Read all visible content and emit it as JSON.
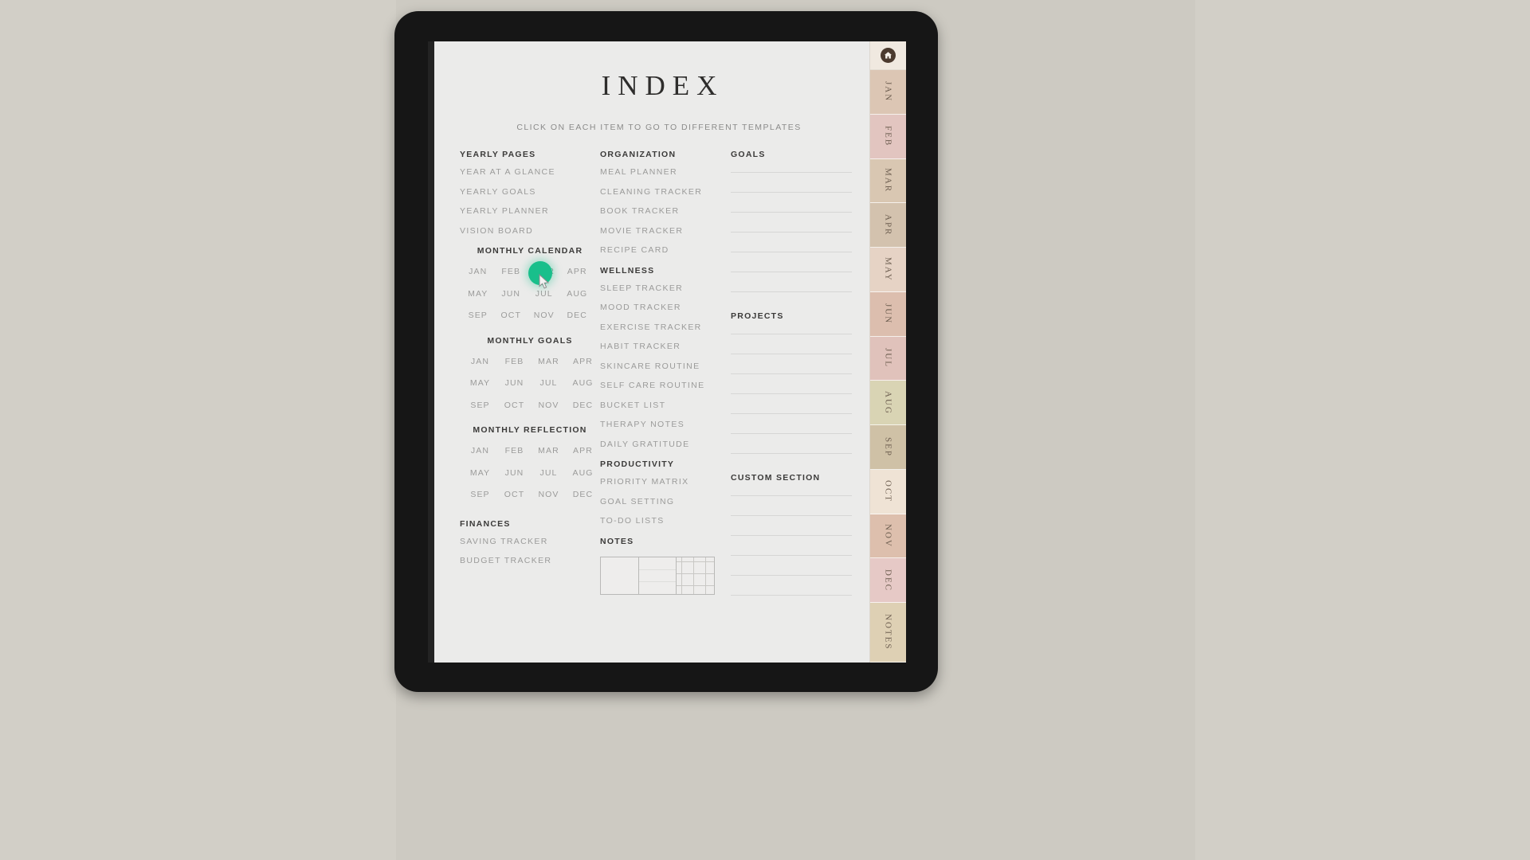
{
  "page": {
    "title": "INDEX",
    "subtitle": "CLICK ON EACH ITEM TO GO TO DIFFERENT TEMPLATES"
  },
  "columns": {
    "left": {
      "yearly": {
        "heading": "YEARLY PAGES",
        "items": [
          "YEAR AT A GLANCE",
          "YEARLY GOALS",
          "YEARLY PLANNER",
          "VISION BOARD"
        ]
      },
      "monthly_calendar": {
        "heading": "MONTHLY CALENDAR",
        "months": [
          "JAN",
          "FEB",
          "MAR",
          "APR",
          "MAY",
          "JUN",
          "JUL",
          "AUG",
          "SEP",
          "OCT",
          "NOV",
          "DEC"
        ]
      },
      "monthly_goals": {
        "heading": "MONTHLY GOALS",
        "months": [
          "JAN",
          "FEB",
          "MAR",
          "APR",
          "MAY",
          "JUN",
          "JUL",
          "AUG",
          "SEP",
          "OCT",
          "NOV",
          "DEC"
        ]
      },
      "monthly_reflection": {
        "heading": "MONTHLY REFLECTION",
        "months": [
          "JAN",
          "FEB",
          "MAR",
          "APR",
          "MAY",
          "JUN",
          "JUL",
          "AUG",
          "SEP",
          "OCT",
          "NOV",
          "DEC"
        ]
      },
      "finances": {
        "heading": "FINANCES",
        "items": [
          "SAVING TRACKER",
          "BUDGET TRACKER"
        ]
      }
    },
    "middle": {
      "organization": {
        "heading": "ORGANIZATION",
        "items": [
          "MEAL PLANNER",
          "CLEANING TRACKER",
          "BOOK TRACKER",
          "MOVIE TRACKER",
          "RECIPE CARD"
        ]
      },
      "wellness": {
        "heading": "WELLNESS",
        "items": [
          "SLEEP TRACKER",
          "MOOD TRACKER",
          "EXERCISE TRACKER",
          "HABIT TRACKER",
          "SKINCARE ROUTINE",
          "SELF CARE ROUTINE",
          "BUCKET LIST",
          "THERAPY NOTES",
          "DAILY GRATITUDE"
        ]
      },
      "productivity": {
        "heading": "PRODUCTIVITY",
        "items": [
          "PRIORITY MATRIX",
          "GOAL SETTING",
          "TO-DO LISTS"
        ]
      },
      "notes": {
        "heading": "NOTES",
        "box_types": [
          "blank",
          "lined",
          "grid"
        ]
      }
    },
    "right": {
      "goals": {
        "heading": "GOALS",
        "line_count": 7
      },
      "projects": {
        "heading": "PROJECTS",
        "line_count": 7
      },
      "custom_section": {
        "heading": "CUSTOM SECTION",
        "line_count": 6
      }
    }
  },
  "tab_strip": {
    "home_icon": "home-icon",
    "tabs": [
      {
        "label": "JAN",
        "color": "#dcc6b4"
      },
      {
        "label": "FEB",
        "color": "#e2c5c0"
      },
      {
        "label": "MAR",
        "color": "#d9c7b2"
      },
      {
        "label": "APR",
        "color": "#d3c2ae"
      },
      {
        "label": "MAY",
        "color": "#e6d3c5"
      },
      {
        "label": "JUN",
        "color": "#dcbeae"
      },
      {
        "label": "JUL",
        "color": "#e0c2bb"
      },
      {
        "label": "AUG",
        "color": "#d9d4b4"
      },
      {
        "label": "SEP",
        "color": "#cfc1a6"
      },
      {
        "label": "OCT",
        "color": "#efe3d5"
      },
      {
        "label": "NOV",
        "color": "#ddbfad"
      },
      {
        "label": "DEC",
        "color": "#e6c9c6"
      },
      {
        "label": "NOTES",
        "color": "#ded0b4"
      }
    ]
  },
  "cursor": {
    "highlight_color": "#19bf8b",
    "target_label": "FEB",
    "target_section": "MONTHLY CALENDAR"
  }
}
